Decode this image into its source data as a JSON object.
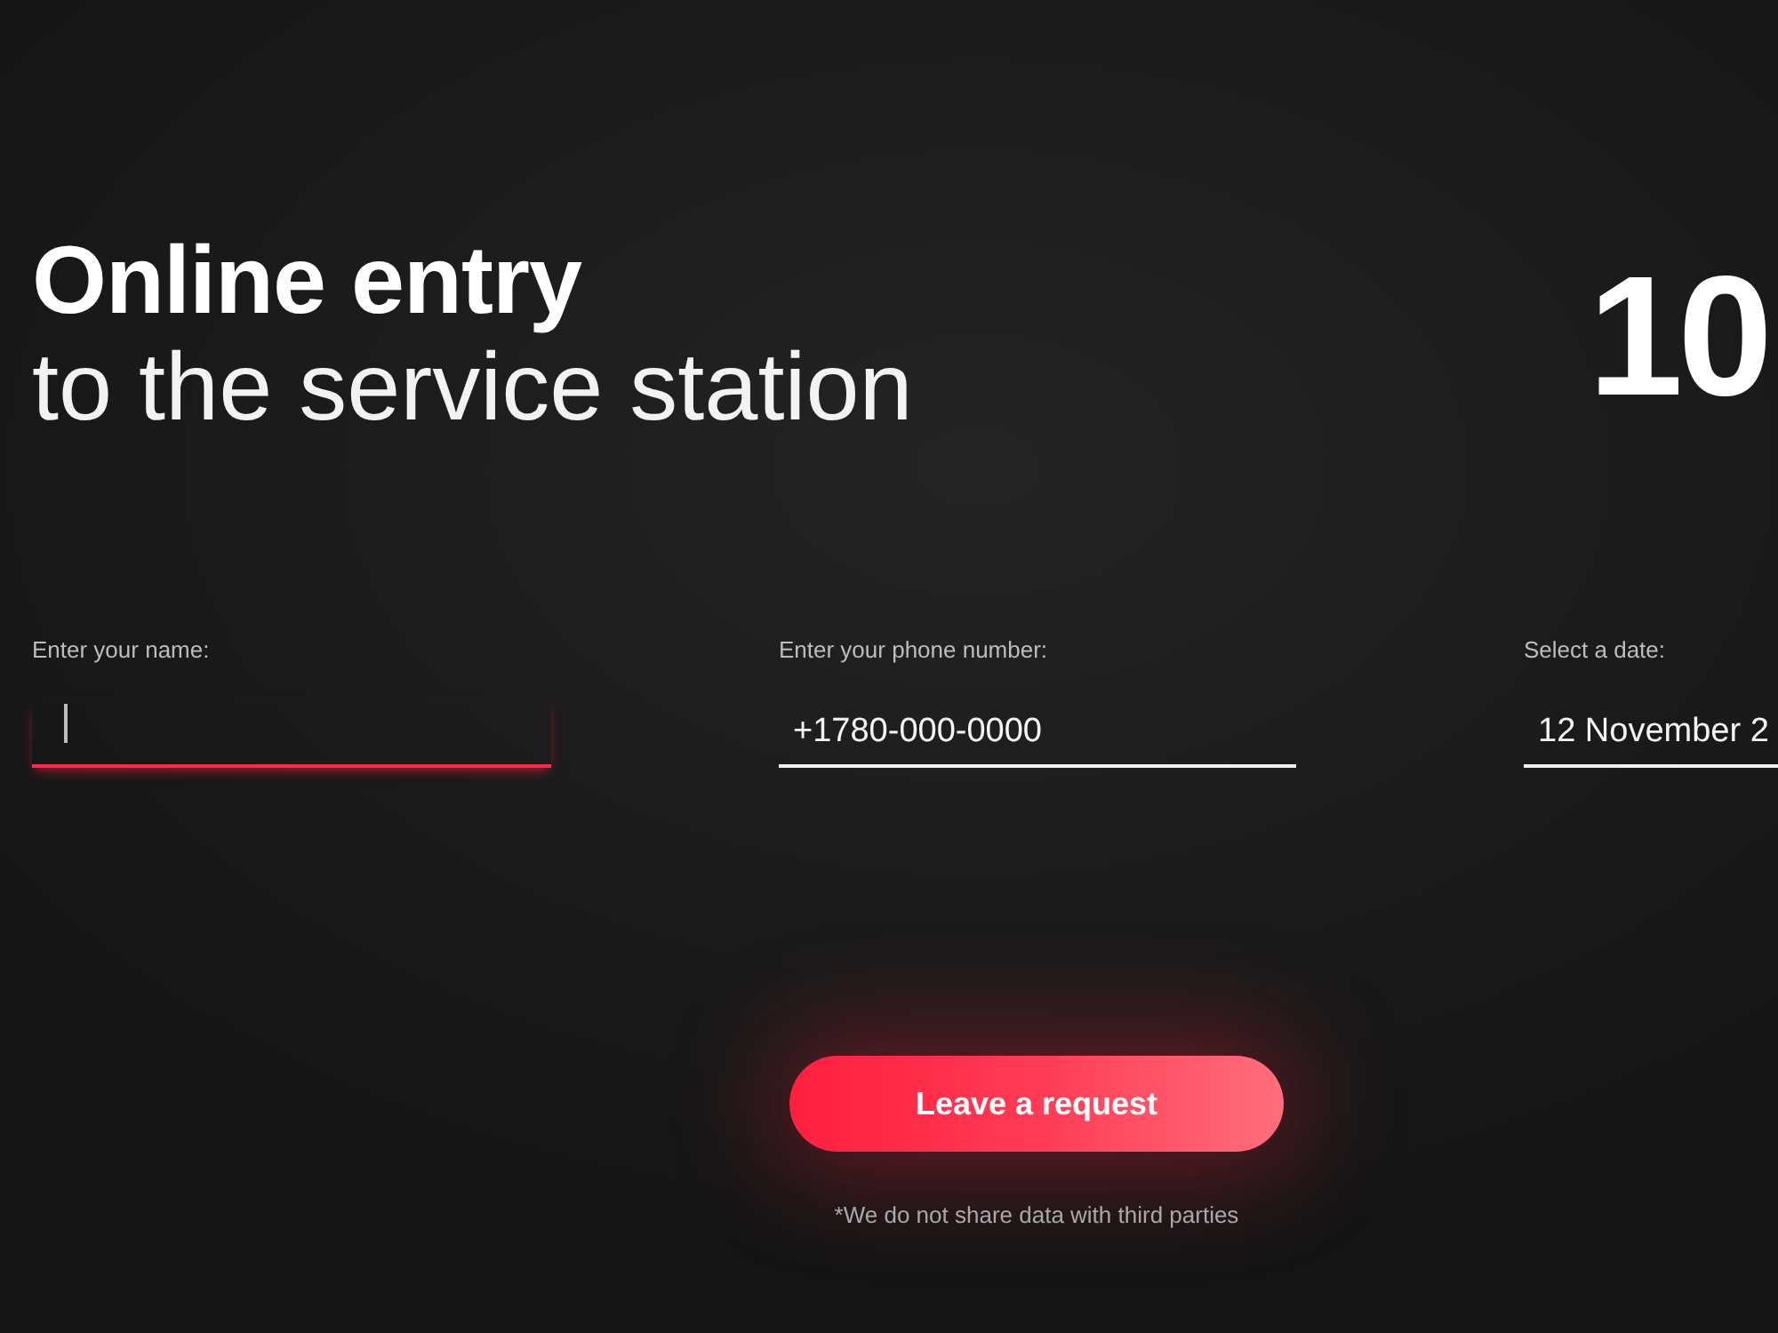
{
  "title": "Online entry",
  "subtitle": "to the service station",
  "large_number": "10",
  "fields": [
    {
      "label": "Enter your name:",
      "focused": true
    },
    {
      "label": "Enter your phone number:",
      "value": "+1780-000-0000",
      "focused": false
    },
    {
      "label": "Select a date:",
      "value": "12 November 2",
      "focused": false
    }
  ],
  "submit_button": "Leave a request",
  "note": "*We do not share data with third parties"
}
